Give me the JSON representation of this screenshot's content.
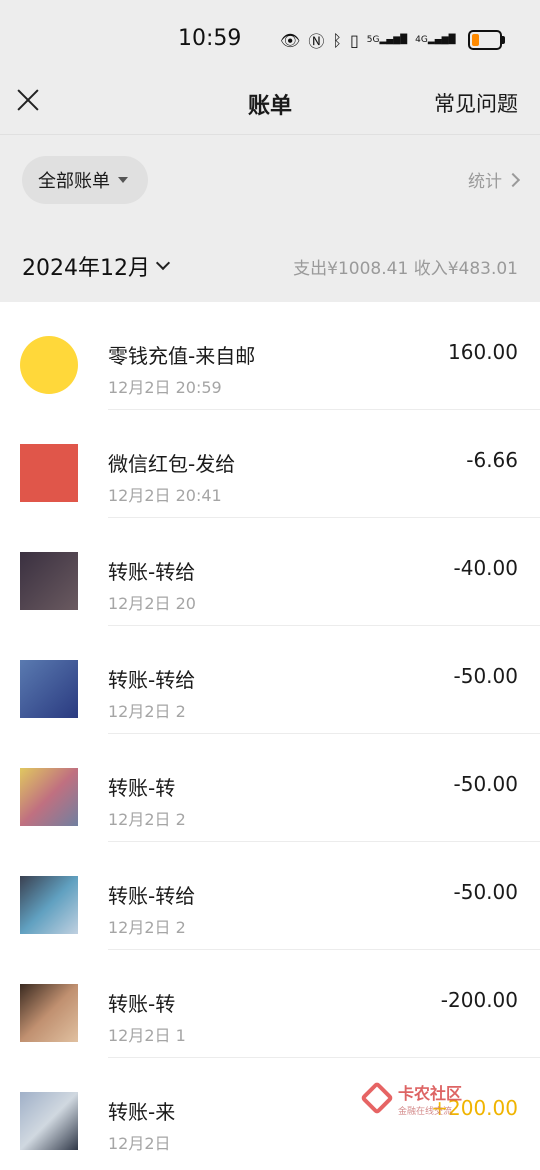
{
  "status_bar": {
    "time": "10:59",
    "icons": [
      "eye-icon",
      "nfc-icon",
      "bluetooth-icon",
      "vibrate-icon",
      "signal-5g-icon",
      "signal-4g-icon",
      "battery-low-icon"
    ],
    "net1": "5G",
    "net2": "4G"
  },
  "nav": {
    "title": "账单",
    "help": "常见问题"
  },
  "filter": {
    "label": "全部账单",
    "stats_label": "统计"
  },
  "month_header": {
    "month": "2024年12月",
    "summary": "支出¥1008.41  收入¥483.01"
  },
  "transactions": [
    {
      "title": "零钱充值-来自邮",
      "date": "12月2日 20:59",
      "amount": "160.00",
      "type": "income-neutral",
      "avatar": [
        "#ffd83a",
        "#ffd83a",
        "#ffd83a",
        "#ffd83a"
      ]
    },
    {
      "title": "微信红包-发给",
      "date": "12月2日 20:41",
      "amount": "-6.66",
      "type": "expense"
    },
    {
      "title": "转账-转给",
      "date": "12月2日 20",
      "amount": "-40.00",
      "type": "expense"
    },
    {
      "title": "转账-转给",
      "date": "12月2日 2",
      "amount": "-50.00",
      "type": "expense"
    },
    {
      "title": "转账-转",
      "date": "12月2日 2",
      "amount": "-50.00",
      "type": "expense"
    },
    {
      "title": "转账-转给",
      "date": "12月2日 2",
      "amount": "-50.00",
      "type": "expense"
    },
    {
      "title": "转账-转",
      "date": "12月2日 1",
      "amount": "-200.00",
      "type": "expense"
    },
    {
      "title": "转账-来",
      "date": "12月2日",
      "amount": "+200.00",
      "type": "income"
    }
  ],
  "watermark": {
    "name": "卡农社区",
    "sub": "金融在线交流"
  },
  "colors": {
    "income": "#f0b400",
    "background_header": "#ededed"
  }
}
